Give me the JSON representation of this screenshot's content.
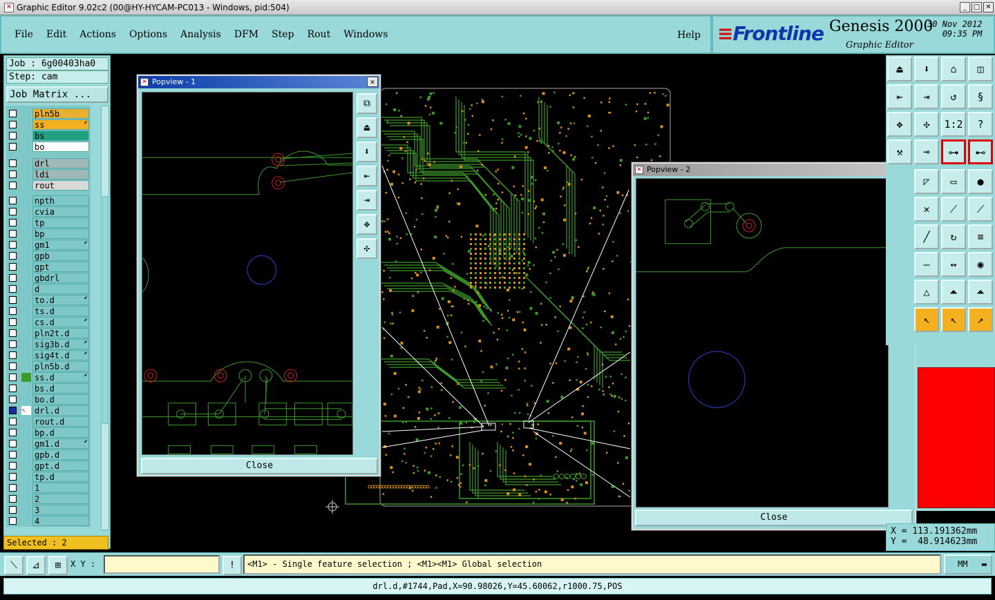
{
  "window": {
    "title": "Graphic Editor 9.02c2 (00@HY-HYCAM-PC013 - Windows, pid:504)"
  },
  "menu": [
    "File",
    "Edit",
    "Actions",
    "Options",
    "Analysis",
    "DFM",
    "Step",
    "Rout",
    "Windows"
  ],
  "help_label": "Help",
  "brand": {
    "logo": "Frontline",
    "product": "Genesis 2000",
    "subtitle": "Graphic Editor",
    "date": "30 Nov 2012",
    "time": "09:35 PM"
  },
  "job": {
    "job_line": "Job : 6g00403ha0",
    "step_line": "Step: cam",
    "matrix_button": "Job Matrix ..."
  },
  "layers": [
    {
      "name": "pln5b",
      "color": "#e8b030"
    },
    {
      "name": "ss",
      "color": "#f5b020",
      "arrow": true
    },
    {
      "name": "bs",
      "color": "#20a080"
    },
    {
      "name": "bo",
      "color": "#ffffff"
    },
    {
      "name": "drl",
      "color": "#a0b8b8"
    },
    {
      "name": "ldi",
      "color": "#a0b8b8"
    },
    {
      "name": "rout",
      "color": "#d8d8d8"
    },
    {
      "name": "npth",
      "color": "#7fc8c8"
    },
    {
      "name": "cvia",
      "color": "#7fc8c8"
    },
    {
      "name": "tp",
      "color": "#7fc8c8"
    },
    {
      "name": "bp",
      "color": "#7fc8c8"
    },
    {
      "name": "gm1",
      "color": "#7fc8c8",
      "arrow": true
    },
    {
      "name": "gpb",
      "color": "#7fc8c8"
    },
    {
      "name": "gpt",
      "color": "#7fc8c8"
    },
    {
      "name": "gbdrl",
      "color": "#7fc8c8"
    },
    {
      "name": "d",
      "color": "#7fc8c8"
    },
    {
      "name": "to.d",
      "color": "#7fc8c8",
      "arrow": true
    },
    {
      "name": "ts.d",
      "color": "#7fc8c8"
    },
    {
      "name": "cs.d",
      "color": "#7fc8c8",
      "arrow": true
    },
    {
      "name": "pln2t.d",
      "color": "#7fc8c8"
    },
    {
      "name": "sig3b.d",
      "color": "#7fc8c8",
      "arrow": true
    },
    {
      "name": "sig4t.d",
      "color": "#7fc8c8",
      "arrow": true
    },
    {
      "name": "pln5b.d",
      "color": "#7fc8c8"
    },
    {
      "name": "ss.d",
      "color": "#7fc8c8",
      "arrow": true,
      "swatch": "#3c9a2a"
    },
    {
      "name": "bs.d",
      "color": "#7fc8c8"
    },
    {
      "name": "bo.d",
      "color": "#7fc8c8"
    },
    {
      "name": "drl.d",
      "color": "#7fc8c8",
      "active": true,
      "swatch": "#e84040"
    },
    {
      "name": "rout.d",
      "color": "#7fc8c8"
    },
    {
      "name": "bp.d",
      "color": "#7fc8c8"
    },
    {
      "name": "gm1.d",
      "color": "#7fc8c8",
      "arrow": true
    },
    {
      "name": "gpb.d",
      "color": "#7fc8c8"
    },
    {
      "name": "gpt.d",
      "color": "#7fc8c8"
    },
    {
      "name": "tp.d",
      "color": "#7fc8c8"
    },
    {
      "name": "1",
      "color": "#7fc8c8"
    },
    {
      "name": "2",
      "color": "#7fc8c8"
    },
    {
      "name": "3",
      "color": "#7fc8c8"
    },
    {
      "name": "4",
      "color": "#7fc8c8"
    }
  ],
  "selected": "Selected : 2",
  "popview1": {
    "title": "Popview - 1",
    "close": "Close"
  },
  "popview2": {
    "title": "Popview - 2",
    "close": "Close"
  },
  "coords": {
    "x": "X = 113.191362mm",
    "y": "Y =  48.914623mm"
  },
  "bottom": {
    "xy_label": "X Y :",
    "xy_value": "",
    "hint": "<M1> - Single feature selection ; <M1><M1> Global selection",
    "units": "MM"
  },
  "status": "drl.d,#1744,Pad,X=90.98026,Y=45.60062,r1000.75,POS",
  "colors": {
    "panel": "#9ad9d9",
    "trace": "#3c9a2a",
    "pad": "#d89020",
    "hole_circle": "#3040d0"
  }
}
